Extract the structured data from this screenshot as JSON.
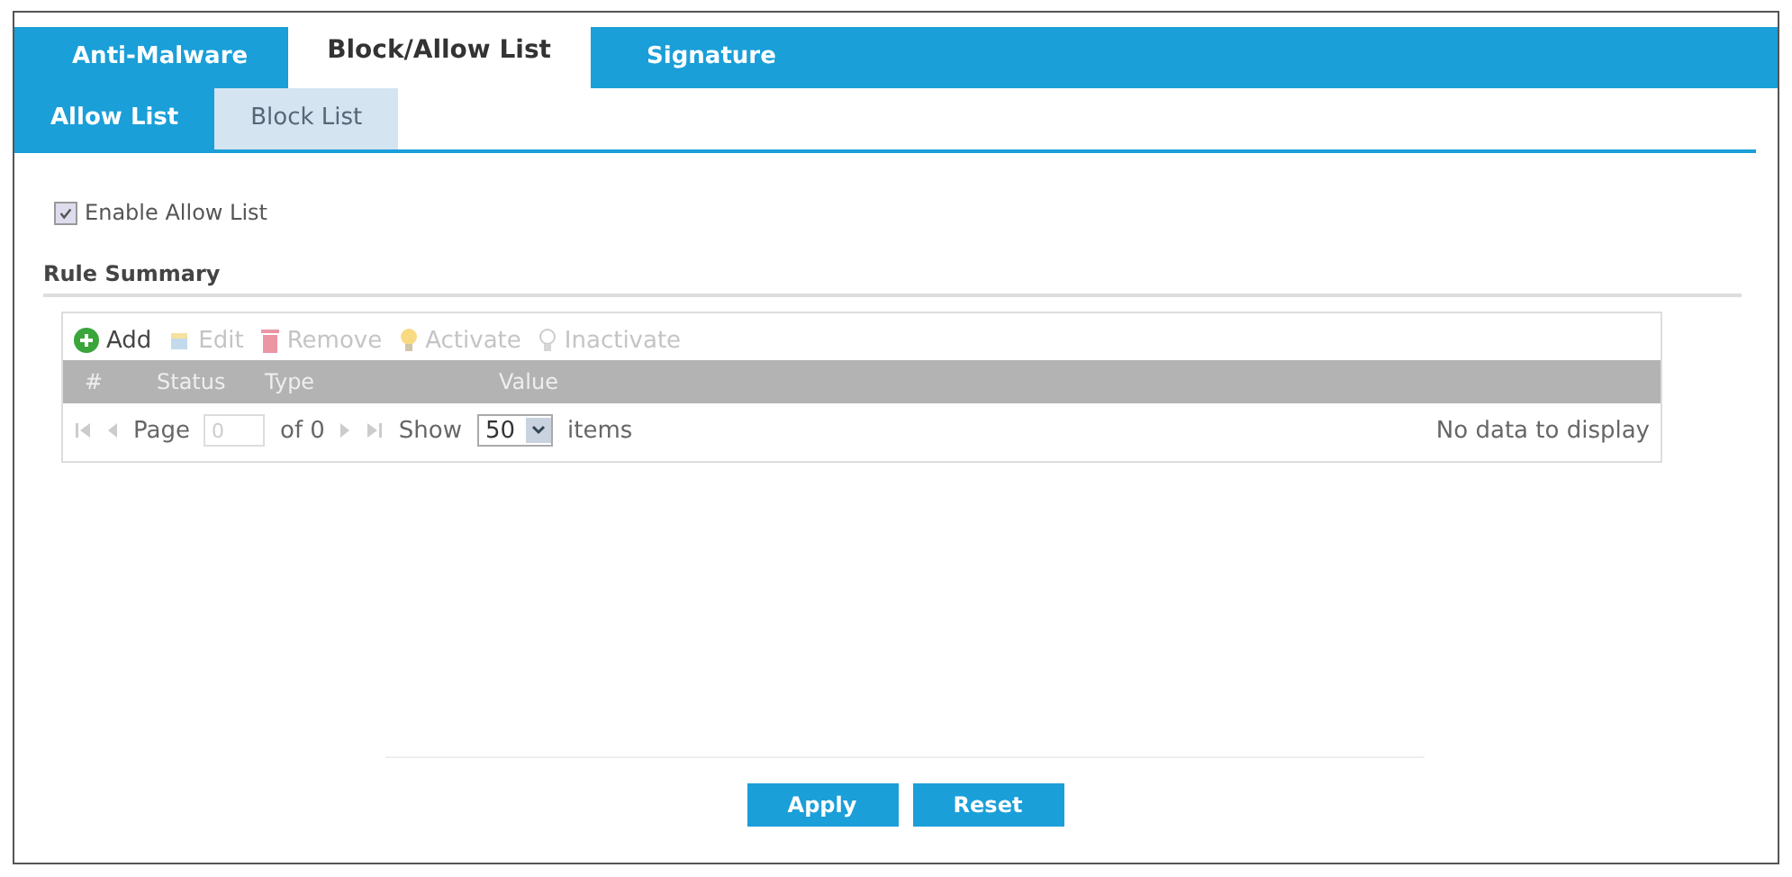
{
  "tabs": [
    {
      "label": "Anti-Malware",
      "selected": false
    },
    {
      "label": "Block/Allow List",
      "selected": true
    },
    {
      "label": "Signature",
      "selected": false
    }
  ],
  "subtabs": [
    {
      "label": "Allow List",
      "selected": true
    },
    {
      "label": "Block List",
      "selected": false
    }
  ],
  "enable": {
    "label": "Enable Allow List",
    "checked": true
  },
  "section_title": "Rule Summary",
  "toolbar": [
    {
      "label": "Add",
      "kind": "add",
      "disabled": false
    },
    {
      "label": "Edit",
      "kind": "edit",
      "disabled": true
    },
    {
      "label": "Remove",
      "kind": "remove",
      "disabled": true
    },
    {
      "label": "Activate",
      "kind": "activate",
      "disabled": true
    },
    {
      "label": "Inactivate",
      "kind": "inactivate",
      "disabled": true
    }
  ],
  "table": {
    "columns": [
      "#",
      "Status",
      "Type",
      "Value"
    ]
  },
  "pager": {
    "page_label": "Page",
    "page_value": "0",
    "of": "of 0",
    "show": "Show",
    "per_page": "50",
    "items": "items",
    "empty": "No data to display"
  },
  "buttons": [
    "Apply",
    "Reset"
  ]
}
